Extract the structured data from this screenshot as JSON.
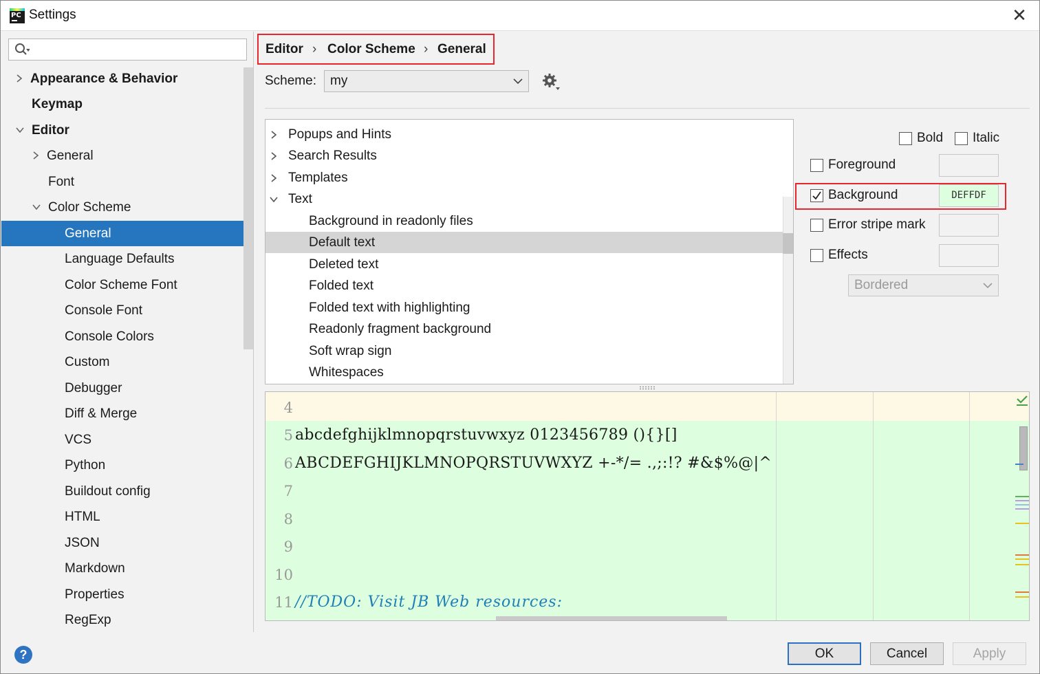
{
  "window": {
    "title": "Settings"
  },
  "search": {
    "placeholder": ""
  },
  "sidebar": {
    "items": [
      {
        "label": "Appearance & Behavior"
      },
      {
        "label": "Keymap"
      },
      {
        "label": "Editor"
      },
      {
        "label": "General"
      },
      {
        "label": "Font"
      },
      {
        "label": "Color Scheme"
      },
      {
        "label": "General"
      },
      {
        "label": "Language Defaults"
      },
      {
        "label": "Color Scheme Font"
      },
      {
        "label": "Console Font"
      },
      {
        "label": "Console Colors"
      },
      {
        "label": "Custom"
      },
      {
        "label": "Debugger"
      },
      {
        "label": "Diff & Merge"
      },
      {
        "label": "VCS"
      },
      {
        "label": "Python"
      },
      {
        "label": "Buildout config"
      },
      {
        "label": "HTML"
      },
      {
        "label": "JSON"
      },
      {
        "label": "Markdown"
      },
      {
        "label": "Properties"
      },
      {
        "label": "RegExp"
      }
    ]
  },
  "breadcrumb": {
    "part1": "Editor",
    "part2": "Color Scheme",
    "part3": "General",
    "separator": "›"
  },
  "scheme": {
    "label": "Scheme:",
    "value": "my"
  },
  "categories": {
    "items": [
      {
        "label": "Popups and Hints"
      },
      {
        "label": "Search Results"
      },
      {
        "label": "Templates"
      },
      {
        "label": "Text"
      },
      {
        "label": "Background in readonly files"
      },
      {
        "label": "Default text"
      },
      {
        "label": "Deleted text"
      },
      {
        "label": "Folded text"
      },
      {
        "label": "Folded text with highlighting"
      },
      {
        "label": "Readonly fragment background"
      },
      {
        "label": "Soft wrap sign"
      },
      {
        "label": "Whitespaces"
      }
    ]
  },
  "attributes": {
    "bold": {
      "label": "Bold",
      "checked": false
    },
    "italic": {
      "label": "Italic",
      "checked": false
    },
    "foreground": {
      "label": "Foreground",
      "checked": false,
      "value": ""
    },
    "background": {
      "label": "Background",
      "checked": true,
      "value": "DEFFDF"
    },
    "error_stripe": {
      "label": "Error stripe mark",
      "checked": false,
      "value": ""
    },
    "effects": {
      "label": "Effects",
      "checked": false,
      "value": "",
      "style": "Bordered"
    }
  },
  "preview": {
    "line_numbers": [
      "4",
      "5",
      "6",
      "7",
      "8",
      "9",
      "10",
      "11"
    ],
    "lines": {
      "l5": "abcdefghijklmnopqrstuvwxyz 0123456789 (){}[]",
      "l6": "ABCDEFGHIJKLMNOPQRSTUVWXYZ +-*/= .,;:!? #&$%@|^",
      "l11": "//TODO: Visit JB Web resources:"
    },
    "background_color": "#DEFFDF"
  },
  "buttons": {
    "ok": "OK",
    "cancel": "Cancel",
    "apply": "Apply",
    "help": "?"
  },
  "colors": {
    "selection": "#2675BF",
    "highlight_border": "#E8262D",
    "comment": "#1E7FB7"
  }
}
